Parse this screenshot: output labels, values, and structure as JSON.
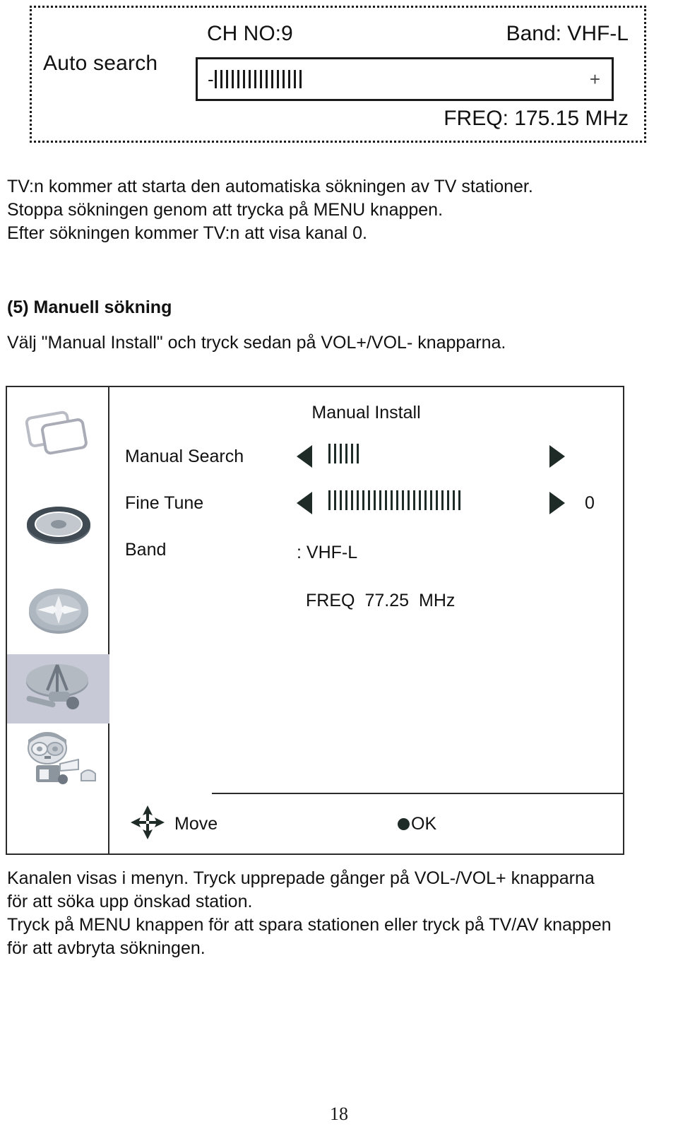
{
  "auto_search_osd": {
    "label": "Auto search",
    "ch_no": "CH NO:9",
    "band": "Band: VHF-L",
    "minus": "-",
    "plus": "+",
    "signal_bar_count": 16,
    "freq": "FREQ: 175.15 MHz"
  },
  "body": {
    "auto_search_paragraph_line1": "TV:n kommer att starta den automatiska sökningen av TV stationer.",
    "auto_search_paragraph_line2": "Stoppa sökningen genom att trycka på MENU knappen.",
    "auto_search_paragraph_line3": "Efter sökningen kommer TV:n att visa kanal 0.",
    "manual_heading": "(5) Manuell sökning",
    "manual_intro": "Välj \"Manual Install\" och tryck sedan på VOL+/VOL- knapparna.",
    "bottom_line1": "Kanalen visas i menyn. Tryck upprepade gånger på VOL-/VOL+ knapparna",
    "bottom_line2": "för att söka upp önskad station.",
    "bottom_line3": "Tryck på MENU knappen för att spara stationen eller tryck på TV/AV knappen",
    "bottom_line4": "för att avbryta sökningen."
  },
  "osd_menu": {
    "title": "Manual Install",
    "sidebar_icons": [
      {
        "name": "picture-icon",
        "selected": false
      },
      {
        "name": "sound-disc-icon",
        "selected": false
      },
      {
        "name": "compass-feature-icon",
        "selected": false
      },
      {
        "name": "satellite-dish-install-icon",
        "selected": true
      },
      {
        "name": "setup-person-icon",
        "selected": false
      }
    ],
    "rows": [
      {
        "label": "Manual Search",
        "bar_count": 6,
        "value": ""
      },
      {
        "label": "Fine Tune",
        "bar_count": 24,
        "value": "0"
      },
      {
        "label": "Band",
        "value": ": VHF-L"
      }
    ],
    "freq_label": "FREQ",
    "freq_value": "77.25",
    "freq_unit": "MHz",
    "footer": {
      "move_label": "Move",
      "ok_label": "OK"
    },
    "colors": {
      "selected_row_bg": "#c7cad6",
      "border": "#2b2b2b",
      "glyph": "#1e2b26"
    }
  },
  "page_number": "18"
}
